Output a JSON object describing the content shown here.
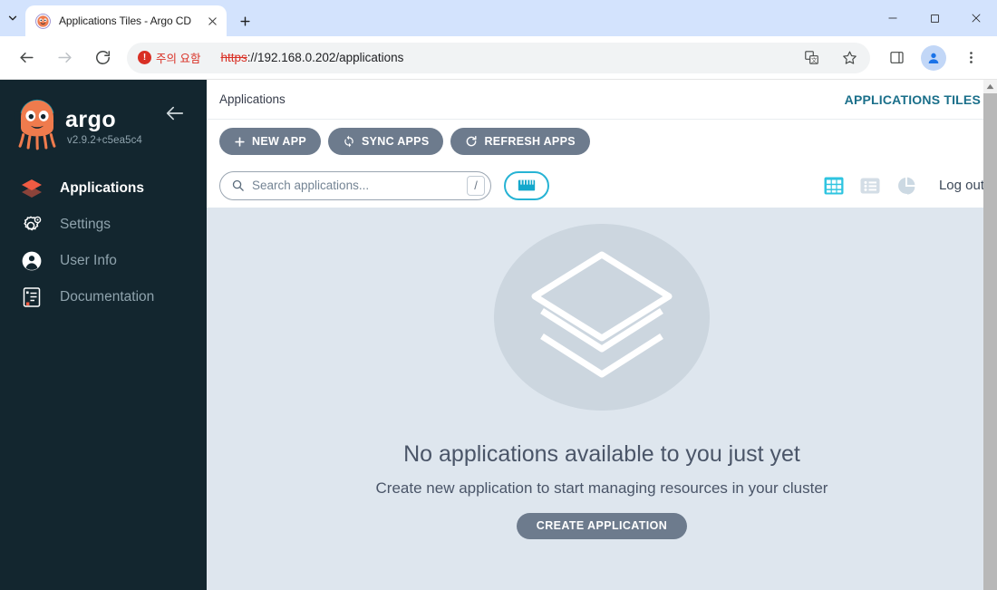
{
  "browser": {
    "tab": {
      "title": "Applications Tiles - Argo CD",
      "favicon_name": "argo-octopus-favicon",
      "close_label": "×"
    },
    "new_tab_label": "+",
    "tab_search_name": "tab-search-chevron",
    "window_controls": {
      "minimize": "−",
      "maximize": "□",
      "close": "×"
    },
    "toolbar": {
      "back_label": "Back",
      "forward_label": "Forward",
      "reload_label": "Reload",
      "security_badge": "주의 요함",
      "security_icon": "not-secure-icon",
      "url_scheme": "https",
      "url_rest": "://192.168.0.202/applications",
      "translate_icon": "translate-icon",
      "bookmark_icon": "star-icon",
      "sidepanel_icon": "side-panel-icon",
      "profile_icon": "profile-avatar-icon",
      "menu_icon": "three-dot-menu-icon"
    }
  },
  "sidebar": {
    "brand_name": "argo",
    "version": "v2.9.2+c5ea5c4",
    "collapse_label": "Collapse",
    "items": [
      {
        "label": "Applications",
        "icon": "layers-icon",
        "active": true
      },
      {
        "label": "Settings",
        "icon": "gear-icon",
        "active": false
      },
      {
        "label": "User Info",
        "icon": "user-circle-icon",
        "active": false
      },
      {
        "label": "Documentation",
        "icon": "book-icon",
        "active": false
      }
    ]
  },
  "topbar": {
    "breadcrumb": "Applications",
    "view_title": "APPLICATIONS TILES"
  },
  "actions": {
    "new_app": "NEW APP",
    "sync_apps": "SYNC APPS",
    "refresh_apps": "REFRESH APPS"
  },
  "filters": {
    "search_placeholder": "Search applications...",
    "search_value": "",
    "shortcut_key": "/",
    "filter_toggle_name": "filter-columns-icon",
    "views": [
      {
        "name": "tiles-view-icon",
        "active": true
      },
      {
        "name": "list-view-icon",
        "active": false
      },
      {
        "name": "summary-pie-view-icon",
        "active": false
      }
    ],
    "logout": "Log out"
  },
  "empty_state": {
    "illustration": "stacked-layers-illustration",
    "title": "No applications available to you just yet",
    "subtitle": "Create new application to start managing resources in your cluster",
    "button": "CREATE APPLICATION"
  },
  "colors": {
    "sidebar_bg": "#13262f",
    "accent_teal": "#26b3d4",
    "brand_orange": "#ef7b4d",
    "page_bg": "#dee6ee",
    "pill_gray": "#6d7b8d",
    "warn_red": "#d93025"
  }
}
